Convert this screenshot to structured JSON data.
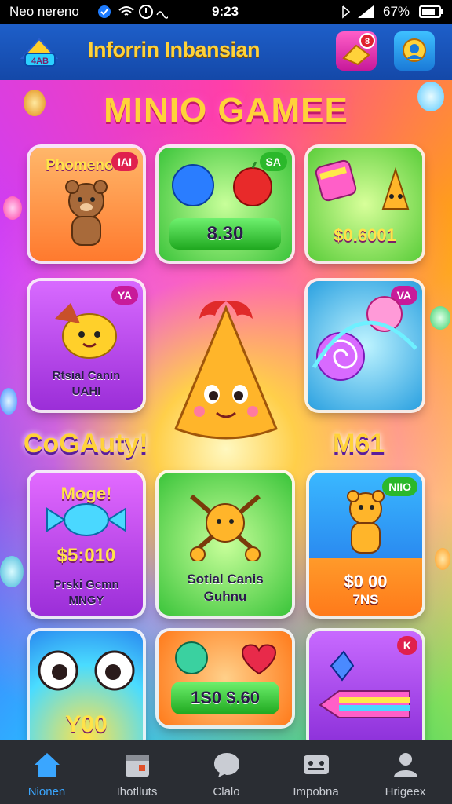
{
  "status_bar": {
    "left_text": "Neo nereno",
    "time": "9:23",
    "battery": "67%"
  },
  "app_bar": {
    "title": "Inforrin Inbansian",
    "logo_text": "4AB",
    "notification_count": "8"
  },
  "hero": {
    "title": "MINIO GAMEE",
    "left_label": "CoGAuty!",
    "right_label": "M61"
  },
  "cards": [
    {
      "title": "Phomeno",
      "tag": "IAI"
    },
    {
      "tag": "SA",
      "price": "8.30"
    },
    {
      "price": "$0.6001"
    },
    {
      "tag": "YA",
      "caption": "Rtsial Canin",
      "caption2": "UAHI"
    },
    {
      "tag": "VA"
    },
    {
      "title": "Moge!",
      "price": "$5:010",
      "caption": "Prski Gcmn",
      "caption2": "MNGY"
    },
    {
      "caption": "Sotial Canis",
      "caption2": "Guhnu"
    },
    {
      "tag": "NIIO",
      "price": "$0 00",
      "caption2": "7NS"
    },
    {
      "price": "Y00"
    },
    {
      "price": "1S0 $.60"
    },
    {
      "tag": "K"
    }
  ],
  "nav": [
    {
      "label": "Nionen",
      "icon": "home-icon"
    },
    {
      "label": "Ihotlluts",
      "icon": "calendar-icon"
    },
    {
      "label": "Clalo",
      "icon": "chat-icon"
    },
    {
      "label": "Impobna",
      "icon": "gamepad-icon"
    },
    {
      "label": "Hrigeex",
      "icon": "profile-icon"
    }
  ]
}
